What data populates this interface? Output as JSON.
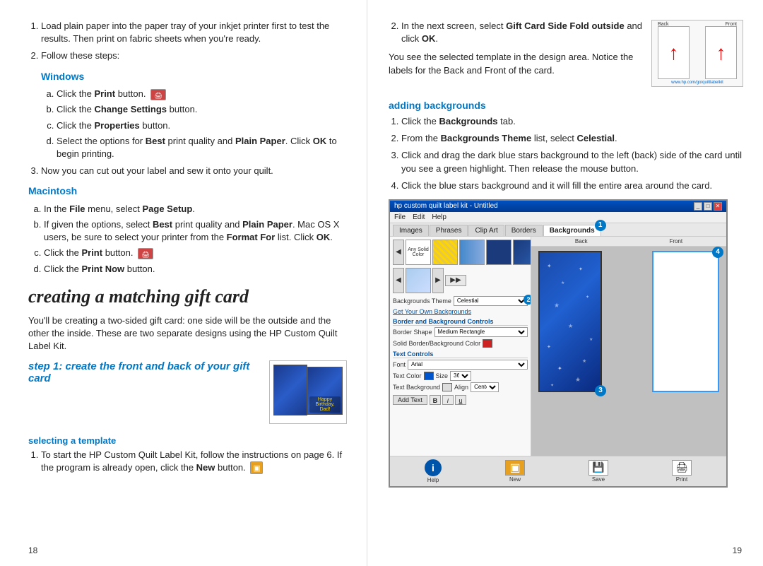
{
  "left": {
    "list_items": [
      {
        "text": "Load plain paper into the paper tray of your inkjet printer first to test the results. Then print on fabric sheets when you're ready."
      },
      {
        "text": "Follow these steps:"
      }
    ],
    "windows_heading": "Windows",
    "windows_steps": [
      {
        "label": "a",
        "prefix": "Click the ",
        "bold": "Print",
        "suffix": " button."
      },
      {
        "label": "b",
        "prefix": "Click the ",
        "bold": "Change Settings",
        "suffix": " button."
      },
      {
        "label": "c",
        "prefix": "Click the ",
        "bold": "Properties",
        "suffix": " button."
      },
      {
        "label": "d",
        "prefix": "Select the options for ",
        "bold1": "Best",
        "mid": " print quality and ",
        "bold2": "Plain Paper",
        "suffix": ". Click ",
        "bold3": "OK",
        "suffix2": " to begin printing."
      }
    ],
    "list_item_3": "Now you can cut out your label and sew it onto your quilt.",
    "macintosh_heading": "Macintosh",
    "mac_steps": [
      {
        "label": "a",
        "prefix": "In the ",
        "bold1": "File",
        "mid": " menu, select ",
        "bold2": "Page Setup",
        "suffix": "."
      },
      {
        "label": "b",
        "prefix": "If given the options, select ",
        "bold1": "Best",
        "mid": " print quality and ",
        "bold2": "Plain",
        "br": true,
        "line2": "Paper",
        "line2_suffix": ". Mac OS X users, be sure to select your printer from the ",
        "bold3": "Format For",
        "suffix2": " list. Click ",
        "bold4": "OK",
        "suffix3": "."
      },
      {
        "label": "c",
        "prefix": "Click the ",
        "bold": "Print",
        "suffix": " button."
      },
      {
        "label": "d",
        "prefix": "Click the ",
        "bold": "Print Now",
        "suffix": " button."
      }
    ],
    "big_title": "creating a matching gift card",
    "intro_text": "You'll be creating a two-sided gift card: one side will be the outside and the other the inside. These are two separate designs using the HP Custom Quilt Label Kit.",
    "step1_heading": "step 1: create the front and back of your gift card",
    "selecting_template_heading": "selecting a template",
    "selecting_list": [
      {
        "text": "To start the HP Custom Quilt Label Kit, follow the instructions on page 6. If the program is already open, click the "
      }
    ],
    "new_label": "New",
    "page_num": "18"
  },
  "right": {
    "list_item_2": "In the next screen, select ",
    "bold_gift": "Gift Card Side Fold outside",
    "suffix_2": " and click ",
    "bold_ok": "OK",
    "template_text1": "You see the selected template in the design area. Notice the labels for the Back and Front of the card.",
    "adding_backgrounds_heading": "adding backgrounds",
    "bg_steps": [
      {
        "prefix": "Click the ",
        "bold": "Backgrounds",
        "suffix": " tab."
      },
      {
        "prefix": "From the ",
        "bold": "Backgrounds Theme",
        "suffix": " list, select ",
        "bold2": "Celestial",
        "suffix2": "."
      },
      {
        "text": "Click and drag the dark blue stars background to the left (back) side of the card until you see a green highlight. Then release the mouse button."
      },
      {
        "text": "Click the blue stars background and it will fill the entire area around the card."
      }
    ],
    "page_num": "19",
    "software": {
      "title": "hp custom quilt label kit - Untitled",
      "menu": [
        "File",
        "Edit",
        "Help"
      ],
      "tabs": [
        "Images",
        "Phrases",
        "Clip Art",
        "Borders",
        "Backgrounds"
      ],
      "active_tab": "Backgrounds",
      "theme_label": "Backgrounds Theme",
      "theme_value": "Celestial",
      "get_own_text": "Get Your Own Backgrounds",
      "border_section": "Border and Background Controls",
      "border_shape_label": "Border Shape",
      "border_shape_value": "Medium Rectangle",
      "solid_border_label": "Solid Border/Background Color",
      "text_controls": "Text Controls",
      "font_label": "Font",
      "font_value": "Arial",
      "size_label": "Size",
      "size_value": "36",
      "text_color_label": "Text Color",
      "text_bg_label": "Text Background",
      "align_label": "Align",
      "align_value": "Center",
      "add_text_btn": "Add Text",
      "bottom_buttons": [
        "Help",
        "New",
        "Save",
        "Print"
      ],
      "canvas_labels": [
        "Back",
        "Front"
      ],
      "callout_nums": [
        "1",
        "2",
        "3",
        "4"
      ]
    }
  }
}
